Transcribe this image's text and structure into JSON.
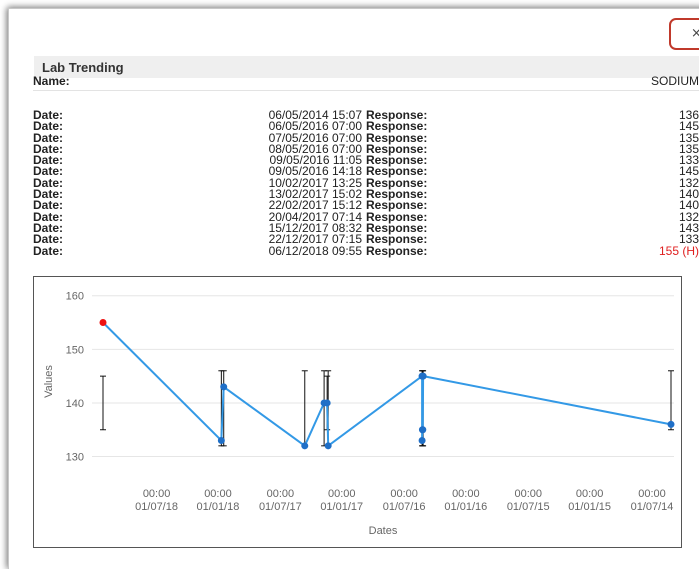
{
  "dialog": {
    "close_glyph": "×",
    "title": "Lab Trending"
  },
  "name_row": {
    "label": "Name:",
    "value": "SODIUM"
  },
  "results": [
    {
      "date_label": "Date:",
      "date": "06/05/2014 15:07",
      "response_label": "Response:",
      "response": "136",
      "high": false
    },
    {
      "date_label": "Date:",
      "date": "06/05/2016 07:00",
      "response_label": "Response:",
      "response": "145",
      "high": false
    },
    {
      "date_label": "Date:",
      "date": "07/05/2016 07:00",
      "response_label": "Response:",
      "response": "135",
      "high": false
    },
    {
      "date_label": "Date:",
      "date": "08/05/2016 07:00",
      "response_label": "Response:",
      "response": "135",
      "high": false
    },
    {
      "date_label": "Date:",
      "date": "09/05/2016 11:05",
      "response_label": "Response:",
      "response": "133",
      "high": false
    },
    {
      "date_label": "Date:",
      "date": "09/05/2016 14:18",
      "response_label": "Response:",
      "response": "145",
      "high": false
    },
    {
      "date_label": "Date:",
      "date": "10/02/2017 13:25",
      "response_label": "Response:",
      "response": "132",
      "high": false
    },
    {
      "date_label": "Date:",
      "date": "13/02/2017 15:02",
      "response_label": "Response:",
      "response": "140",
      "high": false
    },
    {
      "date_label": "Date:",
      "date": "22/02/2017 15:12",
      "response_label": "Response:",
      "response": "140",
      "high": false
    },
    {
      "date_label": "Date:",
      "date": "20/04/2017 07:14",
      "response_label": "Response:",
      "response": "132",
      "high": false
    },
    {
      "date_label": "Date:",
      "date": "15/12/2017 08:32",
      "response_label": "Response:",
      "response": "143",
      "high": false
    },
    {
      "date_label": "Date:",
      "date": "22/12/2017 07:15",
      "response_label": "Response:",
      "response": "133",
      "high": false
    },
    {
      "date_label": "Date:",
      "date": "06/12/2018 09:55",
      "response_label": "Response:",
      "response": "155 (H)",
      "high": true
    }
  ],
  "colors": {
    "line": "#3399e6",
    "point": "#1f6fc7",
    "high_point": "#ee1111",
    "close_border": "#c0392b"
  },
  "chart_data": {
    "type": "line",
    "xlabel": "Dates",
    "ylabel": "Values",
    "ylim": [
      126,
      162
    ],
    "yticks": [
      130,
      140,
      150,
      160
    ],
    "x_reversed": true,
    "xticks": [
      {
        "date": "2018-07-01",
        "line1": "00:00",
        "line2": "01/07/18"
      },
      {
        "date": "2018-01-01",
        "line1": "00:00",
        "line2": "01/01/18"
      },
      {
        "date": "2017-07-01",
        "line1": "00:00",
        "line2": "01/07/17"
      },
      {
        "date": "2017-01-01",
        "line1": "00:00",
        "line2": "01/01/17"
      },
      {
        "date": "2016-07-01",
        "line1": "00:00",
        "line2": "01/07/16"
      },
      {
        "date": "2016-01-01",
        "line1": "00:00",
        "line2": "01/01/16"
      },
      {
        "date": "2015-07-01",
        "line1": "00:00",
        "line2": "01/07/15"
      },
      {
        "date": "2015-01-01",
        "line1": "00:00",
        "line2": "01/01/15"
      },
      {
        "date": "2014-07-01",
        "line1": "00:00",
        "line2": "01/07/14"
      }
    ],
    "x_range": [
      "2018-12-06",
      "2014-05-06"
    ],
    "points": [
      {
        "date": "2018-12-06",
        "value": 155,
        "high": true
      },
      {
        "date": "2017-12-22",
        "value": 133
      },
      {
        "date": "2017-12-15",
        "value": 143
      },
      {
        "date": "2017-04-20",
        "value": 132
      },
      {
        "date": "2017-02-22",
        "value": 140
      },
      {
        "date": "2017-02-13",
        "value": 140
      },
      {
        "date": "2017-02-10",
        "value": 132
      },
      {
        "date": "2016-05-09",
        "value": 145
      },
      {
        "date": "2016-05-09",
        "value": 133
      },
      {
        "date": "2016-05-08",
        "value": 135
      },
      {
        "date": "2016-05-07",
        "value": 135
      },
      {
        "date": "2016-05-06",
        "value": 145
      },
      {
        "date": "2014-05-06",
        "value": 136
      }
    ],
    "ranges": [
      {
        "date": "2018-12-06",
        "low": 135,
        "high": 145
      },
      {
        "date": "2017-12-22",
        "low": 132,
        "high": 146
      },
      {
        "date": "2017-12-15",
        "low": 132,
        "high": 146
      },
      {
        "date": "2017-04-20",
        "low": 132,
        "high": 146
      },
      {
        "date": "2017-02-22",
        "low": 132,
        "high": 146
      },
      {
        "date": "2017-02-13",
        "low": 135,
        "high": 145
      },
      {
        "date": "2017-02-10",
        "low": 132,
        "high": 146
      },
      {
        "date": "2016-05-09",
        "low": 132,
        "high": 146
      },
      {
        "date": "2016-05-08",
        "low": 132,
        "high": 146
      },
      {
        "date": "2016-05-07",
        "low": 132,
        "high": 146
      },
      {
        "date": "2016-05-06",
        "low": 132,
        "high": 146
      },
      {
        "date": "2014-05-06",
        "low": 135,
        "high": 146
      }
    ]
  }
}
